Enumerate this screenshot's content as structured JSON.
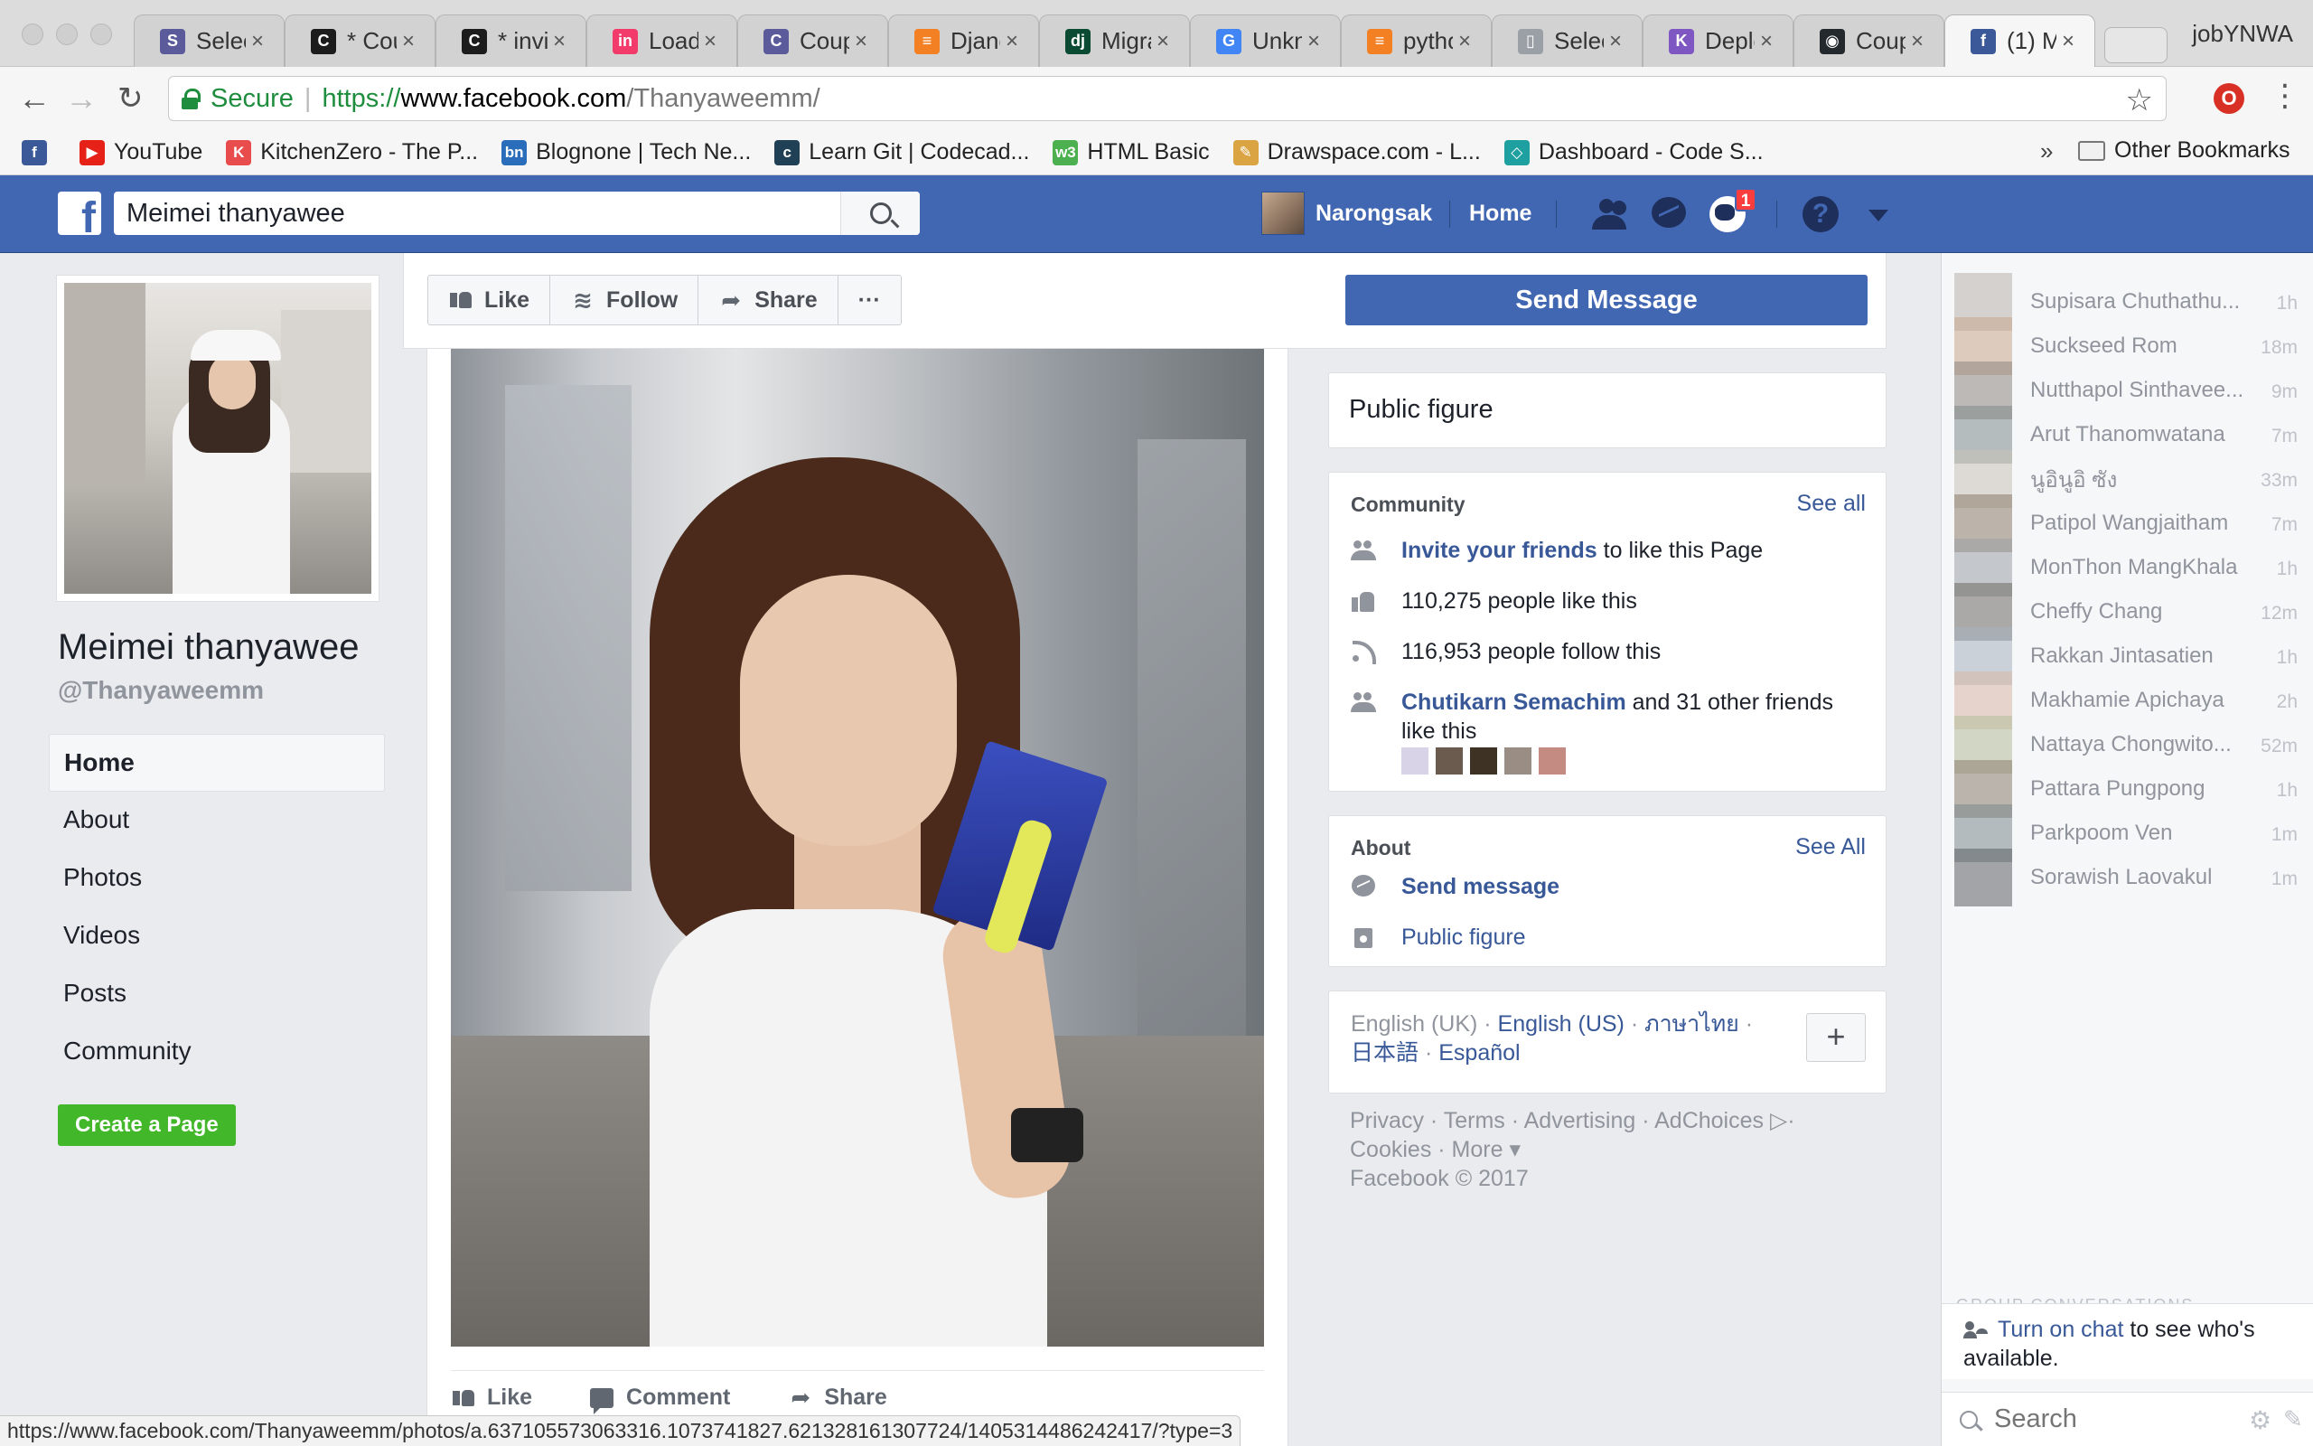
{
  "browser": {
    "profile_name": "jobYNWA",
    "tabs": [
      {
        "title": "Selec",
        "color": "#5b5b9b",
        "glyph": "S"
      },
      {
        "title": "* Cou",
        "color": "#1c1c1c",
        "glyph": "C"
      },
      {
        "title": "* invi",
        "color": "#1c1c1c",
        "glyph": "C"
      },
      {
        "title": "Loadi",
        "color": "#f23a6b",
        "glyph": "in"
      },
      {
        "title": "Coup",
        "color": "#5b5b9b",
        "glyph": "C"
      },
      {
        "title": "Djang",
        "color": "#f48024",
        "glyph": "≡"
      },
      {
        "title": "Migra",
        "color": "#0c4b33",
        "glyph": "dj"
      },
      {
        "title": "Unkn",
        "color": "#4285f4",
        "glyph": "G"
      },
      {
        "title": "pytho",
        "color": "#f48024",
        "glyph": "≡"
      },
      {
        "title": "Selec",
        "color": "#9aa0a6",
        "glyph": "▯"
      },
      {
        "title": "Deplo",
        "color": "#7e57c2",
        "glyph": "K"
      },
      {
        "title": "Coup",
        "color": "#24292e",
        "glyph": "◉"
      },
      {
        "title": "(1) M",
        "color": "#3b5998",
        "glyph": "f"
      }
    ],
    "address": {
      "secure_label": "Secure",
      "url_scheme": "https://",
      "url_host": "www.facebook.com",
      "url_path": "/Thanyaweemm/"
    },
    "bookmarks": [
      {
        "label": "",
        "color": "#3b5998",
        "glyph": "f"
      },
      {
        "label": "YouTube",
        "color": "#e62117",
        "glyph": "▶"
      },
      {
        "label": "KitchenZero - The P...",
        "color": "#e94c4c",
        "glyph": "K"
      },
      {
        "label": "Blognone | Tech Ne...",
        "color": "#2a6ebb",
        "glyph": "bn"
      },
      {
        "label": "Learn Git | Codecad...",
        "color": "#204056",
        "glyph": "c"
      },
      {
        "label": "HTML Basic",
        "color": "#4caf50",
        "glyph": "w3"
      },
      {
        "label": "Drawspace.com - L...",
        "color": "#d9a441",
        "glyph": "✎"
      },
      {
        "label": "Dashboard - Code S...",
        "color": "#1ea0a0",
        "glyph": "◇"
      }
    ],
    "bookmarks_more": "»",
    "other_bookmarks": "Other Bookmarks",
    "status_url": "https://www.facebook.com/Thanyaweemm/photos/a.637105573063316.1073741827.621328161307724/1405314486242417/?type=3"
  },
  "fb_header": {
    "logo": "f",
    "search_value": "Meimei thanyawee",
    "user_name": "Narongsak",
    "home_label": "Home",
    "notification_count": "1",
    "icons": [
      "friends-icon",
      "messenger-icon",
      "globe-icon",
      "help-icon",
      "dropdown-icon"
    ]
  },
  "page": {
    "name": "Meimei thanyawee",
    "handle": "@Thanyaweemm",
    "nav": [
      "Home",
      "About",
      "Photos",
      "Videos",
      "Posts",
      "Community"
    ],
    "active_nav": "Home",
    "create_page_label": "Create a Page"
  },
  "action_bar": {
    "like_label": "Like",
    "follow_label": "Follow",
    "share_label": "Share",
    "more_label": "···",
    "send_message_label": "Send Message"
  },
  "post": {
    "like_label": "Like",
    "comment_label": "Comment",
    "share_label": "Share"
  },
  "right_column": {
    "category": "Public figure",
    "community": {
      "heading": "Community",
      "see_all": "See all",
      "invite_link": "Invite your friends",
      "invite_rest": " to like this Page",
      "likes_text": "110,275 people like this",
      "follows_text": "116,953 people follow this",
      "friends_link": "Chutikarn Semachim",
      "friends_rest": " and 31 other friends like this"
    },
    "about": {
      "heading": "About",
      "see_all": "See All",
      "send_message": "Send message",
      "public_figure": "Public figure"
    },
    "languages": {
      "current": "English (UK)",
      "others": [
        "English (US)",
        "ภาษาไทย",
        "日本語",
        "Español"
      ],
      "plus_label": "+"
    },
    "footer": {
      "line1": "Privacy · Terms · Advertising · AdChoices ▷·",
      "line2": "Cookies · More ▾",
      "line3": "Facebook © 2017"
    }
  },
  "chat": {
    "contacts": [
      {
        "name": "Supisara Chuthathu...",
        "time": "1h"
      },
      {
        "name": "Suckseed Rom",
        "time": "18m"
      },
      {
        "name": "Nutthapol Sinthavee...",
        "time": "9m"
      },
      {
        "name": "Arut Thanomwatana",
        "time": "7m"
      },
      {
        "name": "นูอินูอิ ซัง",
        "time": "33m"
      },
      {
        "name": "Patipol Wangjaitham",
        "time": "7m"
      },
      {
        "name": "MonThon MangKhala",
        "time": "1h"
      },
      {
        "name": "Cheffy Chang",
        "time": "12m"
      },
      {
        "name": "Rakkan Jintasatien",
        "time": "1h"
      },
      {
        "name": "Makhamie Apichaya",
        "time": "2h"
      },
      {
        "name": "Nattaya Chongwito...",
        "time": "52m"
      },
      {
        "name": "Pattara Pungpong",
        "time": "1h"
      },
      {
        "name": "Parkpoom Ven",
        "time": "1m"
      },
      {
        "name": "Sorawish Laovakul",
        "time": "1m"
      }
    ],
    "group_label": "GROUP CONVERSATIONS",
    "turn_on_link": "Turn on chat",
    "turn_on_rest": " to see who's available.",
    "search_placeholder": "Search"
  }
}
